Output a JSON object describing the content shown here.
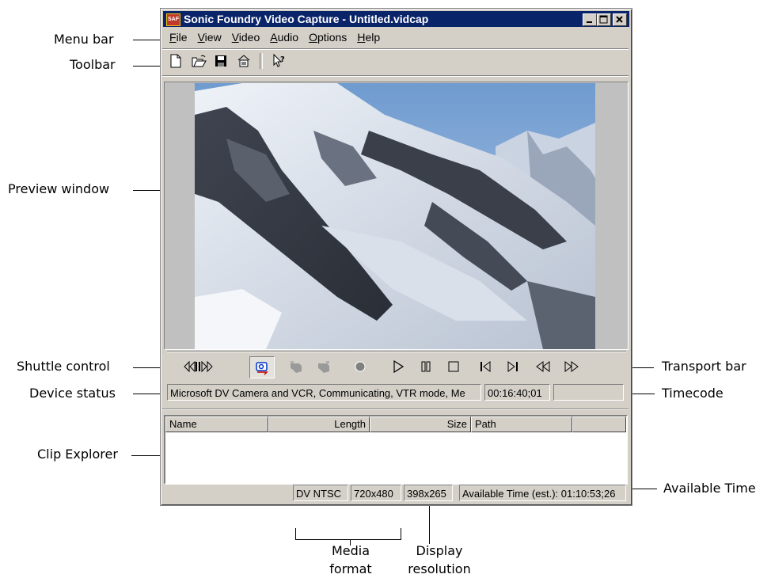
{
  "window": {
    "title": "Sonic Foundry Video Capture - Untitled.vidcap",
    "icon_text": "SAF",
    "controls": [
      "minimize",
      "maximize",
      "close"
    ]
  },
  "menu": [
    "File",
    "View",
    "Video",
    "Audio",
    "Options",
    "Help"
  ],
  "toolbar": [
    "new-file-icon",
    "open-folder-icon",
    "save-icon",
    "properties-icon",
    "whats-this-help-icon"
  ],
  "transport": {
    "shuttle_icon": "shuttle-control-icon",
    "buttons": [
      "device-control-icon",
      "mark-in-icon",
      "mark-out-icon",
      "record-icon",
      "play-icon",
      "pause-icon",
      "stop-icon",
      "go-to-start-icon",
      "go-to-end-icon",
      "rewind-icon",
      "fast-forward-icon"
    ]
  },
  "status": {
    "device": "Microsoft DV Camera and VCR, Communicating, VTR mode, Me",
    "timecode": "00:16:40;01",
    "extra": ""
  },
  "clip_explorer": {
    "columns": [
      "Name",
      "Length",
      "Size",
      "Path",
      ""
    ]
  },
  "bottom_status": {
    "media_format": "DV NTSC",
    "resolution": "720x480",
    "display_resolution": "398x265",
    "available_time": "Available Time (est.): 01:10:53;26"
  },
  "annotations": {
    "menu_bar": "Menu bar",
    "toolbar": "Toolbar",
    "preview_window": "Preview window",
    "shuttle_control": "Shuttle control",
    "device_status": "Device status",
    "clip_explorer": "Clip Explorer",
    "transport_bar": "Transport bar",
    "timecode": "Timecode",
    "available_time": "Available Time",
    "media_format_1": "Media",
    "media_format_2": "format",
    "display_resolution_1": "Display",
    "display_resolution_2": "resolution"
  },
  "colors": {
    "titlebar": "#0a246a",
    "chrome": "#d4d0c8",
    "record": "#808080",
    "device_icon": "#0033cc"
  }
}
